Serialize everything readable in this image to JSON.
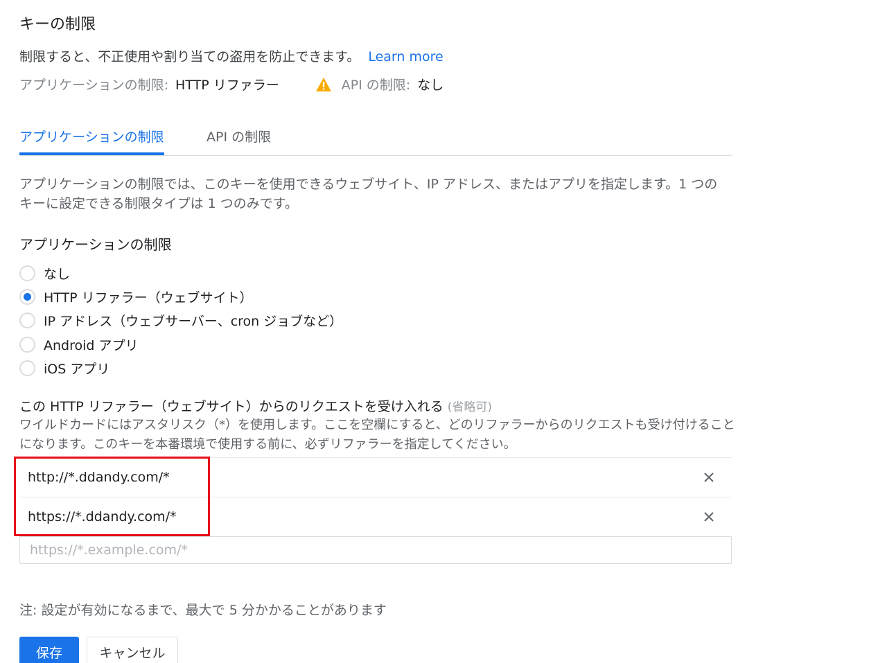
{
  "page": {
    "title": "キーの制限",
    "description": "制限すると、不正使用や割り当ての盗用を防止できます。",
    "learn_more": "Learn more",
    "summary": {
      "app_label": "アプリケーションの制限:",
      "app_value": "HTTP リファラー",
      "api_label": "API の制限:",
      "api_value": "なし",
      "warning_icon": "warning-icon",
      "warning_color": "#f9ab00"
    }
  },
  "tabs": [
    {
      "label": "アプリケーションの制限",
      "active": true
    },
    {
      "label": "API の制限",
      "active": false
    }
  ],
  "app_restrictions": {
    "description": "アプリケーションの制限では、このキーを使用できるウェブサイト、IP アドレス、またはアプリを指定します。1 つのキーに設定できる制限タイプは 1 つのみです。",
    "section_title": "アプリケーションの制限",
    "options": [
      {
        "label": "なし",
        "checked": false
      },
      {
        "label": "HTTP リファラー（ウェブサイト）",
        "checked": true
      },
      {
        "label": "IP アドレス（ウェブサーバー、cron ジョブなど）",
        "checked": false
      },
      {
        "label": "Android アプリ",
        "checked": false
      },
      {
        "label": "iOS アプリ",
        "checked": false
      }
    ]
  },
  "referrers": {
    "title": "この HTTP リファラー（ウェブサイト）からのリクエストを受け入れる",
    "optional": "(省略可)",
    "help": "ワイルドカードにはアスタリスク（*）を使用します。ここを空欄にすると、どのリファラーからのリクエストも受け付けることになります。このキーを本番環境で使用する前に、必ずリファラーを指定してください。",
    "items": [
      "http://*.ddandy.com/*",
      "https://*.ddandy.com/*"
    ],
    "input_placeholder": "https://*.example.com/*",
    "input_value": "",
    "highlight_color": "#e8101a"
  },
  "note": "注: 設定が有効になるまで、最大で 5 分かかることがあります",
  "buttons": {
    "save": "保存",
    "cancel": "キャンセル"
  },
  "colors": {
    "accent": "#1a73e8"
  }
}
